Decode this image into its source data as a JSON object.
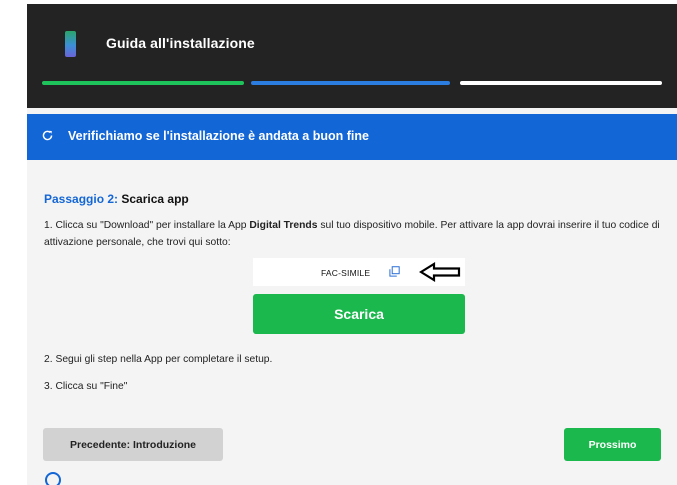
{
  "header": {
    "title": "Guida all'installazione",
    "icon": "smartphone-icon",
    "progress_segments": [
      {
        "state": "completed",
        "color": "#1ec45b"
      },
      {
        "state": "current",
        "color": "#2b7de0"
      },
      {
        "state": "upcoming",
        "color": "#ffffff"
      }
    ]
  },
  "banner": {
    "icon": "refresh-icon",
    "text": "Verifichiamo se l'installazione è andata a buon fine",
    "color": "#1366d6"
  },
  "step": {
    "prefix": "Passaggio 2:",
    "name": " Scarica app",
    "instruction1_a": "1. Clicca su \"Download\" per installare la App ",
    "instruction1_bold": "Digital Trends",
    "instruction1_b": " sul tuo dispositivo mobile. Per attivare la app dovrai inserire il tuo codice di attivazione personale, che trovi qui sotto:",
    "activation_code": "FAC-SIMILE",
    "download_label": "Scarica",
    "instruction2": "2. Segui gli step nella App per completare il setup.",
    "instruction3": "3. Clicca su \"Fine\""
  },
  "footer": {
    "prev_label": "Precedente: Introduzione",
    "next_label": "Prossimo"
  },
  "colors": {
    "dark_header": "#232323",
    "accent_green": "#1bb84d",
    "accent_blue": "#1366d6"
  }
}
